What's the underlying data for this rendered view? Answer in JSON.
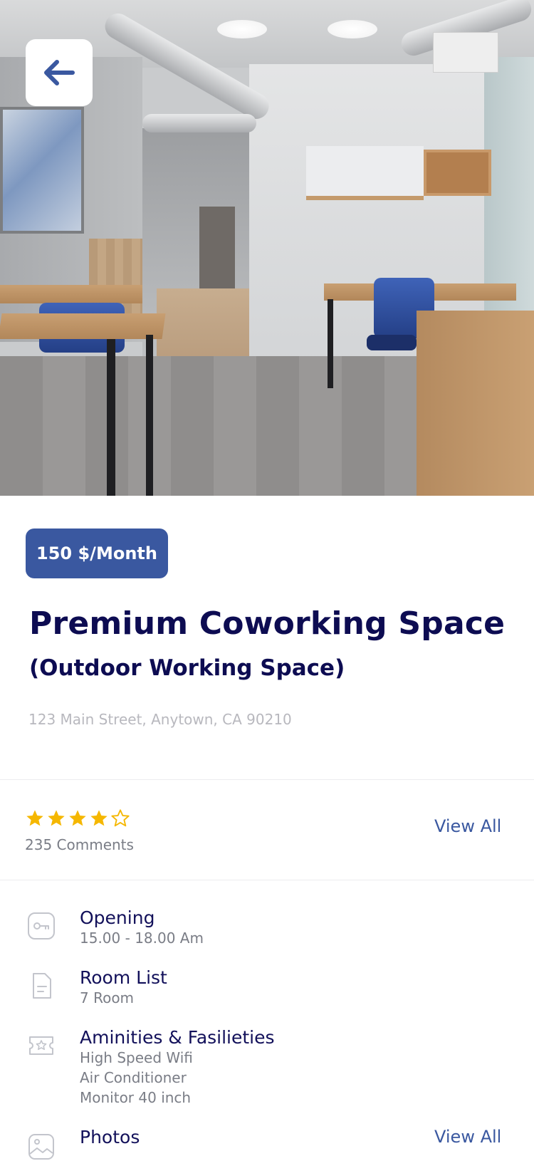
{
  "header": {
    "back_icon": "arrow-left-icon"
  },
  "listing": {
    "price": "150 $/Month",
    "title": "Premium Coworking Space",
    "subtitle": "(Outdoor Working Space)",
    "address": "123 Main Street, Anytown, CA 90210"
  },
  "rating": {
    "stars_filled": 4,
    "stars_total": 5,
    "comments": "235 Comments",
    "view_all": "View All"
  },
  "details": {
    "opening": {
      "icon": "key-icon",
      "title": "Opening",
      "value": "15.00 - 18.00 Am"
    },
    "rooms": {
      "icon": "document-icon",
      "title": "Room List",
      "value": "7 Room"
    },
    "amenities": {
      "icon": "ticket-star-icon",
      "title": "Aminities & Fasilieties",
      "items": [
        "High Speed Wifi",
        "Air Conditioner",
        "Monitor 40 inch"
      ]
    },
    "photos": {
      "icon": "image-icon",
      "title": "Photos",
      "view_all": "View All"
    }
  },
  "colors": {
    "brand": "#3a58a0",
    "title": "#0d0c52",
    "star": "#f5b700",
    "muted": "#7a7d86"
  }
}
